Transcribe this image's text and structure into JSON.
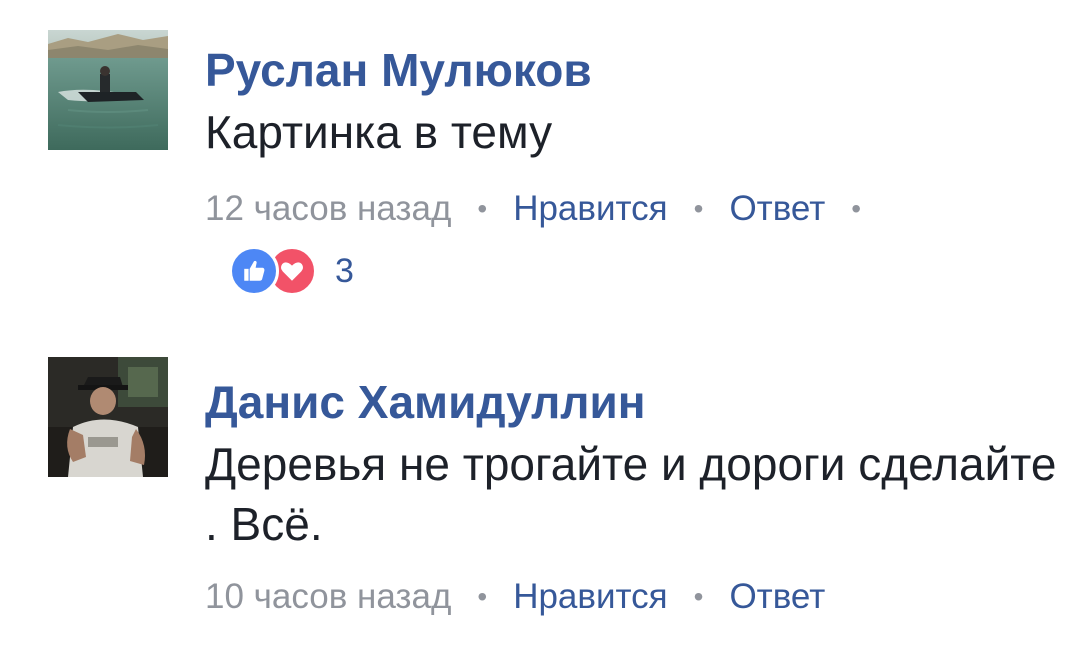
{
  "comments": [
    {
      "author": "Руслан Мулюков",
      "text": "Картинка в тему",
      "time": "12 часов назад",
      "like_label": "Нравится",
      "reply_label": "Ответ",
      "avatar_icon": "jet-ski-photo-avatar",
      "reactions": {
        "icons": [
          "like-icon",
          "love-icon"
        ],
        "count": "3"
      }
    },
    {
      "author": "Данис Хамидуллин",
      "text": "Деревья не трогайте и дороги сделайте . Всё.",
      "time": "10 часов назад",
      "like_label": "Нравится",
      "reply_label": "Ответ",
      "avatar_icon": "man-in-hat-photo-avatar"
    }
  ],
  "colors": {
    "link_blue": "#365899",
    "meta_gray": "#90949c",
    "text_dark": "#1d2129",
    "like_blue": "#4d87f5",
    "love_red": "#f25268"
  }
}
